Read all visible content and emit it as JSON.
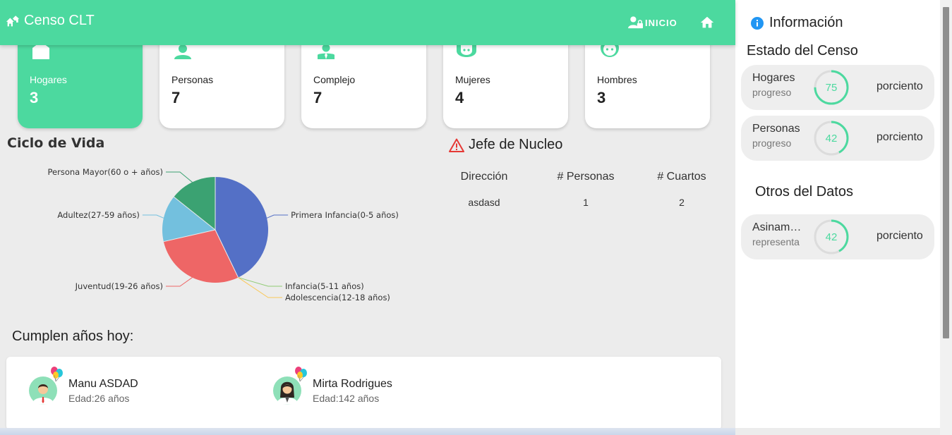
{
  "app": {
    "title": "Censo CLT"
  },
  "nav": {
    "inicio_label": "INICIO"
  },
  "stats": [
    {
      "label": "Hogares",
      "value": "3",
      "icon": "house-icon"
    },
    {
      "label": "Personas",
      "value": "7",
      "icon": "person-icon"
    },
    {
      "label": "Complejo",
      "value": "7",
      "icon": "person-tie-icon"
    },
    {
      "label": "Mujeres",
      "value": "4",
      "icon": "female-face-icon"
    },
    {
      "label": "Hombres",
      "value": "3",
      "icon": "male-face-icon"
    }
  ],
  "ciclo": {
    "title": "Ciclo de Vida"
  },
  "chart_data": {
    "type": "pie",
    "title": "Ciclo de Vida",
    "slices": [
      {
        "label": "Primera Infancia(0-5 años)",
        "value": 3,
        "color": "#5470c6"
      },
      {
        "label": "Infancia(5-11 años)",
        "value": 0,
        "color": "#91cc75"
      },
      {
        "label": "Adolescencia(12-18 años)",
        "value": 0,
        "color": "#fac858"
      },
      {
        "label": "Juventud(19-26 años)",
        "value": 2,
        "color": "#ee6666"
      },
      {
        "label": "Adultez(27-59 años)",
        "value": 1,
        "color": "#73c0de"
      },
      {
        "label": "Persona Mayor(60 o + años)",
        "value": 1,
        "color": "#3ba272"
      }
    ]
  },
  "jefe": {
    "title": "Jefe de Nucleo",
    "columns": [
      "Dirección",
      "# Personas",
      "# Cuartos"
    ],
    "rows": [
      [
        "asdasd",
        "1",
        "2"
      ]
    ]
  },
  "cumple": {
    "title": "Cumplen años hoy:",
    "people": [
      {
        "name": "Manu ASDAD",
        "age": "Edad:26 años"
      },
      {
        "name": "Mirta Rodrigues",
        "age": "Edad:142 años"
      }
    ]
  },
  "info": {
    "title": "Información",
    "estado_title": "Estado del Censo",
    "otros_title": "Otros del Datos",
    "estado": [
      {
        "name": "Hogares",
        "sub": "progreso",
        "percent": 75,
        "unit": "porciento"
      },
      {
        "name": "Personas",
        "sub": "progreso",
        "percent": 42,
        "unit": "porciento"
      }
    ],
    "otros": [
      {
        "name": "Asinamiento",
        "sub": "representa",
        "percent": 42,
        "unit": "porciento"
      }
    ]
  },
  "colors": {
    "brand": "#4cd99f",
    "warning": "#e53935",
    "info": "#2196f3"
  }
}
